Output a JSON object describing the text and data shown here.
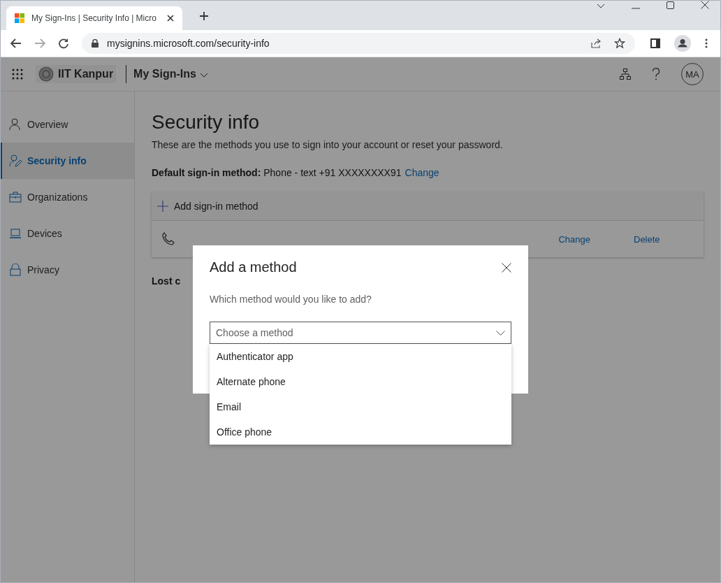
{
  "browser": {
    "tab_title": "My Sign-Ins | Security Info | Micro",
    "url": "mysignins.microsoft.com/security-info"
  },
  "header": {
    "organization": "IIT Kanpur",
    "app_name": "My Sign-Ins",
    "avatar": "MA"
  },
  "sidebar": {
    "items": [
      {
        "label": "Overview",
        "selected": false
      },
      {
        "label": "Security info",
        "selected": true
      },
      {
        "label": "Organizations",
        "selected": false
      },
      {
        "label": "Devices",
        "selected": false
      },
      {
        "label": "Privacy",
        "selected": false
      }
    ]
  },
  "main": {
    "title": "Security info",
    "description": "These are the methods you use to sign into your account or reset your password.",
    "default_method": {
      "text": "**Default sign-in method:** Phone - text +91 XXXXXXXX91",
      "link": "Change"
    },
    "add_method": "Add sign-in method",
    "method_actions": [
      "Change",
      "Delete"
    ],
    "lost_device": "Lost c"
  },
  "dialog": {
    "title": "Add a method",
    "question": "Which method would you like to add?",
    "select": {
      "placeholder": "Choose a method",
      "expanded": true
    },
    "options": [
      "Authenticator app",
      "Alternate phone",
      "Email",
      "Office phone"
    ]
  }
}
